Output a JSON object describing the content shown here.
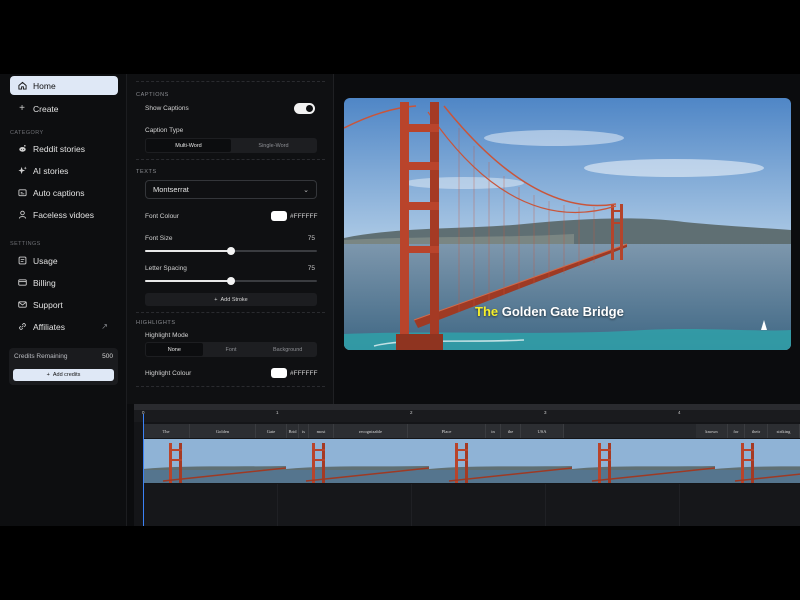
{
  "sidebar": {
    "home": "Home",
    "create": "Create",
    "category_label": "CATEGORY",
    "categories": [
      "Reddit stories",
      "AI stories",
      "Auto captions",
      "Faceless vidoes"
    ],
    "settings_label": "SETTINGS",
    "settings": [
      "Usage",
      "Billing",
      "Support",
      "Affiliates"
    ],
    "credits_label": "Credits Remaining",
    "credits_value": "500",
    "add_credits": "Add credits"
  },
  "panel": {
    "captions_header": "CAPTIONS",
    "show_captions": "Show Captions",
    "show_captions_on": true,
    "caption_type_label": "Caption Type",
    "caption_types": [
      "Multi-Word",
      "Single-Word"
    ],
    "caption_type_selected": "Multi-Word",
    "texts_header": "TEXTS",
    "font": "Montserrat",
    "font_colour_label": "Font Colour",
    "font_colour": "#FFFFFF",
    "font_size_label": "Font Size",
    "font_size": "75",
    "font_size_fraction": 0.5,
    "letter_spacing_label": "Letter Spacing",
    "letter_spacing": "75",
    "letter_spacing_fraction": 0.5,
    "add_stroke": "Add Stroke",
    "highlights_header": "HIGHLIGHTS",
    "highlight_mode_label": "Highlight Mode",
    "highlight_modes": [
      "None",
      "Font",
      "Background"
    ],
    "highlight_mode_selected": "None",
    "highlight_colour_label": "Highlight Colour",
    "highlight_colour": "#FFFFFF"
  },
  "preview": {
    "caption_highlight": "The",
    "caption_rest": "Golden Gate Bridge",
    "highlight_color": "#f5ef2a"
  },
  "timeline": {
    "ticks": [
      "0",
      "1",
      "2",
      "3",
      "4"
    ],
    "words": [
      "The",
      "Golden",
      "Gate",
      "Brid",
      "is",
      "most",
      "recognizable",
      "Place",
      "in",
      "the",
      "USA",
      "known",
      "for",
      "their",
      "striking"
    ]
  },
  "colors": {
    "accent": "#dfe8f6",
    "playhead": "#3b82f6",
    "bridge": "#c0432a"
  }
}
